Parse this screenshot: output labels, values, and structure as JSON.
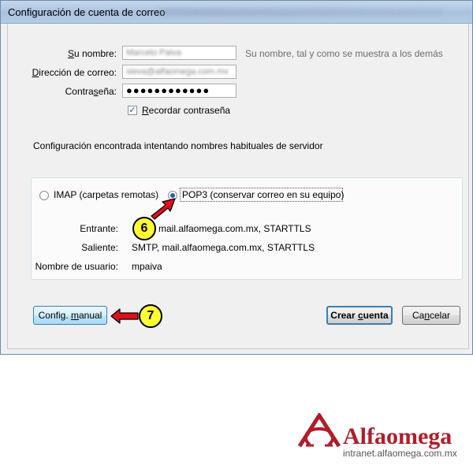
{
  "window": {
    "title": "Configuración de cuenta de correo"
  },
  "form": {
    "name_label_prefix": "",
    "name_label_u": "S",
    "name_label_rest": "u nombre:",
    "name_value": "Marcelo Paiva",
    "name_hint": "Su nombre, tal y como se muestra a los demás",
    "email_label_pre": "",
    "email_label_u": "D",
    "email_label_rest": "irección de correo:",
    "email_value": "sieva@alfaomega.com.mx",
    "password_label_pre": "Contra",
    "password_label_u": "s",
    "password_label_rest": "eña:",
    "password_value": "●●●●●●●●●●●●",
    "remember_u": "R",
    "remember_rest": "ecordar contraseña",
    "remember_checked": true
  },
  "status": {
    "message": "Configuración encontrada intentando nombres habituales de servidor"
  },
  "server": {
    "imap_label": "IMAP (carpetas remotas)",
    "pop3_label": "POP3 (conservar correo en su equipo)",
    "selected": "pop3",
    "incoming_label": "Entrante:",
    "incoming_value": "mail.alfaomega.com.mx, STARTTLS",
    "outgoing_label": "Saliente:",
    "outgoing_value": "SMTP, mail.alfaomega.com.mx, STARTTLS",
    "username_label": "Nombre de usuario:",
    "username_value": "mpaiva"
  },
  "buttons": {
    "manual_pre": "Config. ",
    "manual_u": "m",
    "manual_rest": "anual",
    "create_pre": "Crear ",
    "create_u": "c",
    "create_rest": "uenta",
    "cancel_pre": "Ca",
    "cancel_u": "n",
    "cancel_rest": "celar"
  },
  "callouts": {
    "step6": "6",
    "step7": "7",
    "color_badge": "#ffff33",
    "color_arrow": "#e0101a"
  },
  "brand": {
    "name": "Alfaomega",
    "url": "intranet.alfaomega.com.mx",
    "color": "#b01d2a"
  }
}
